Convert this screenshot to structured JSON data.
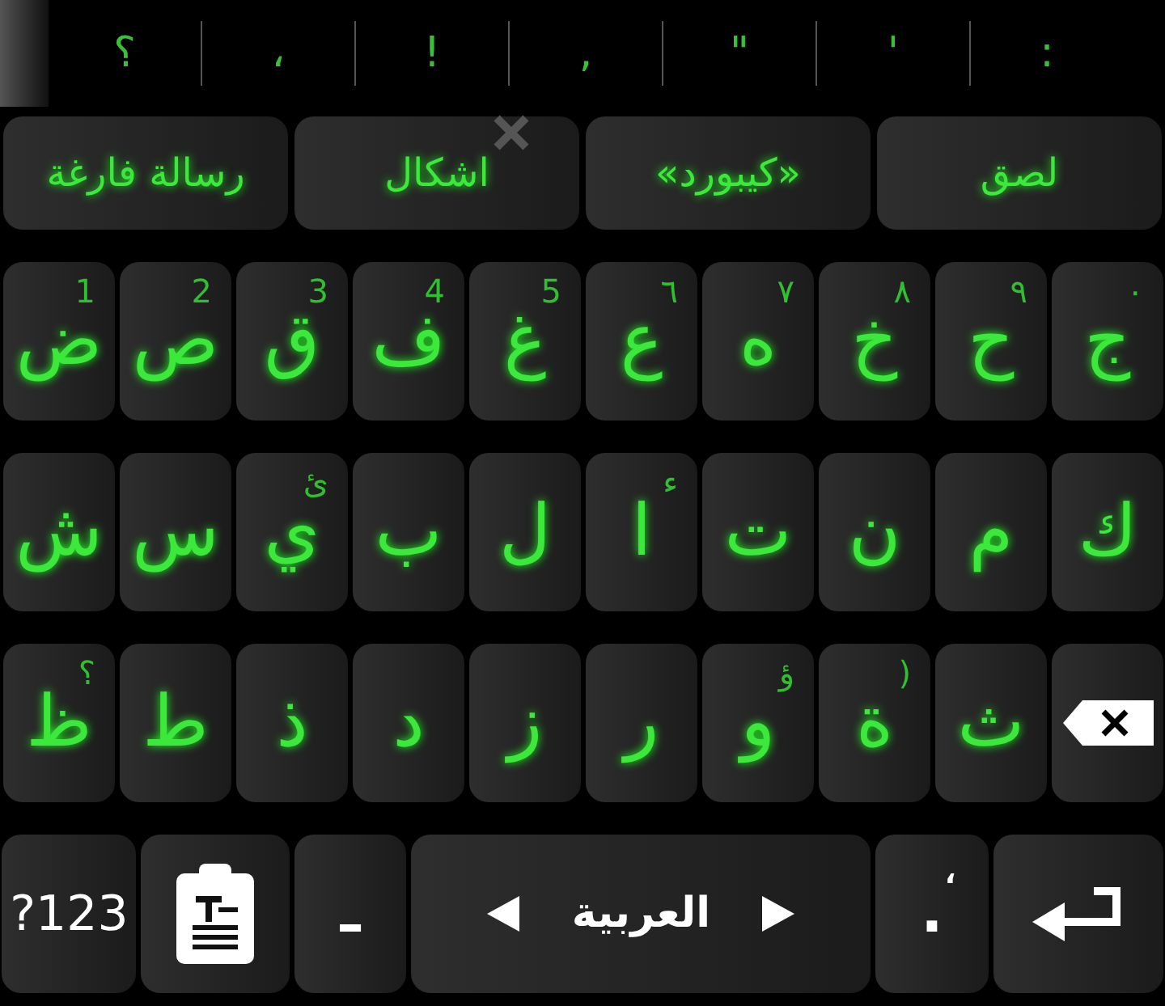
{
  "punctuation_strip": [
    ":",
    "'",
    "\"",
    ",",
    "!",
    "،",
    "؟"
  ],
  "suggestions": [
    {
      "label": "لصق",
      "dismissible": false
    },
    {
      "label": "«كيبورد»",
      "dismissible": false
    },
    {
      "label": "اشكال",
      "dismissible": true
    },
    {
      "label": "رسالة فارغة",
      "dismissible": false
    }
  ],
  "rows": [
    [
      {
        "kind": "letter",
        "label": "ج",
        "hint": "٠"
      },
      {
        "kind": "letter",
        "label": "ح",
        "hint": "٩"
      },
      {
        "kind": "letter",
        "label": "خ",
        "hint": "٨"
      },
      {
        "kind": "letter",
        "label": "ه",
        "hint": "٧"
      },
      {
        "kind": "letter",
        "label": "ع",
        "hint": "٦"
      },
      {
        "kind": "letter",
        "label": "غ",
        "hint": "5"
      },
      {
        "kind": "letter",
        "label": "ف",
        "hint": "4"
      },
      {
        "kind": "letter",
        "label": "ق",
        "hint": "3"
      },
      {
        "kind": "letter",
        "label": "ص",
        "hint": "2"
      },
      {
        "kind": "letter",
        "label": "ض",
        "hint": "1"
      }
    ],
    [
      {
        "kind": "letter",
        "label": "ك"
      },
      {
        "kind": "letter",
        "label": "م"
      },
      {
        "kind": "letter",
        "label": "ن"
      },
      {
        "kind": "letter",
        "label": "ت"
      },
      {
        "kind": "letter",
        "label": "ا",
        "hint": "ء"
      },
      {
        "kind": "letter",
        "label": "ل"
      },
      {
        "kind": "letter",
        "label": "ب"
      },
      {
        "kind": "letter",
        "label": "ي",
        "hint": "ئ"
      },
      {
        "kind": "letter",
        "label": "س"
      },
      {
        "kind": "letter",
        "label": "ش"
      }
    ],
    [
      {
        "kind": "backspace"
      },
      {
        "kind": "letter",
        "label": "ث"
      },
      {
        "kind": "letter",
        "label": "ة",
        "hint": ")"
      },
      {
        "kind": "letter",
        "label": "و",
        "hint": "ؤ"
      },
      {
        "kind": "letter",
        "label": "ر"
      },
      {
        "kind": "letter",
        "label": "ز"
      },
      {
        "kind": "letter",
        "label": "د"
      },
      {
        "kind": "letter",
        "label": "ذ"
      },
      {
        "kind": "letter",
        "label": "ط"
      },
      {
        "kind": "letter",
        "label": "ظ",
        "hint": "؟"
      }
    ],
    [
      {
        "kind": "enter"
      },
      {
        "kind": "white",
        "label": ".",
        "hint": "،"
      },
      {
        "kind": "space",
        "label": "العربية"
      },
      {
        "kind": "white",
        "label": "ـ"
      },
      {
        "kind": "clipboard"
      },
      {
        "kind": "symbols",
        "label": "?123"
      }
    ]
  ]
}
